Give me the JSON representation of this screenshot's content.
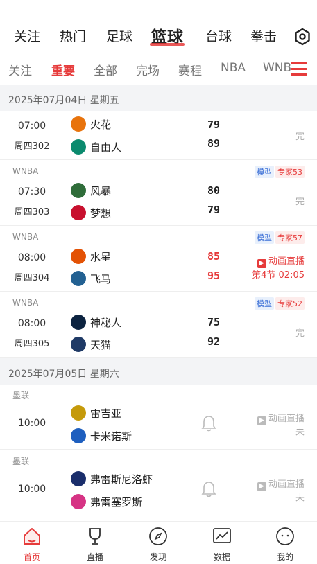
{
  "top_nav": {
    "items": [
      "关注",
      "热门",
      "足球",
      "篮球",
      "台球",
      "拳击"
    ],
    "active_index": 3
  },
  "sub_nav": {
    "items": [
      "关注",
      "重要",
      "全部",
      "完场",
      "赛程",
      "NBA",
      "WNBA"
    ],
    "active_index": 1
  },
  "dates": [
    {
      "label": "2025年07月04日  星期五"
    },
    {
      "label": "2025年07月05日  星期六"
    }
  ],
  "matches": [
    {
      "league": "",
      "time": "07:00",
      "code": "周四302",
      "home": "火花",
      "away": "自由人",
      "home_score": "79",
      "away_score": "89",
      "status": "完",
      "model": "",
      "expert": ""
    },
    {
      "league": "WNBA",
      "time": "07:30",
      "code": "周四303",
      "home": "风暴",
      "away": "梦想",
      "home_score": "80",
      "away_score": "79",
      "status": "完",
      "model": "模型",
      "expert": "专家53"
    },
    {
      "league": "WNBA",
      "time": "08:00",
      "code": "周四304",
      "home": "水星",
      "away": "飞马",
      "home_score": "85",
      "away_score": "95",
      "live_label": "动画直播",
      "live_period": "第4节  02:05",
      "model": "模型",
      "expert": "专家57"
    },
    {
      "league": "WNBA",
      "time": "08:00",
      "code": "周四305",
      "home": "神秘人",
      "away": "天猫",
      "home_score": "75",
      "away_score": "92",
      "status": "完",
      "model": "模型",
      "expert": "专家52"
    },
    {
      "league": "墨联",
      "time": "10:00",
      "code": "",
      "home": "雷吉亚",
      "away": "卡米诺斯",
      "anim_label": "动画直播",
      "status": "未"
    },
    {
      "league": "墨联",
      "time": "10:00",
      "code": "",
      "home": "弗雷斯尼洛虾",
      "away": "弗雷塞罗斯",
      "anim_label": "动画直播",
      "status": "未"
    }
  ],
  "logo_colors": {
    "spark": "#e8730c",
    "liberty": "#0b8a6e",
    "storm": "#2f6d3a",
    "dream": "#c8102e",
    "mercury": "#e35205",
    "lynx": "#236192",
    "mystics": "#0c2340",
    "wolves": "#1f3a66",
    "leon": "#c59a0a",
    "caminos": "#1e5fbf",
    "fresnillo": "#1a2e6b",
    "freseros": "#d63384"
  },
  "accent": "#e63b3b",
  "tab_bar": {
    "items": [
      {
        "label": "首页",
        "icon": "home-icon"
      },
      {
        "label": "直播",
        "icon": "trophy-icon"
      },
      {
        "label": "发现",
        "icon": "compass-icon"
      },
      {
        "label": "数据",
        "icon": "chart-icon"
      },
      {
        "label": "我的",
        "icon": "profile-icon"
      }
    ],
    "active_index": 0
  }
}
